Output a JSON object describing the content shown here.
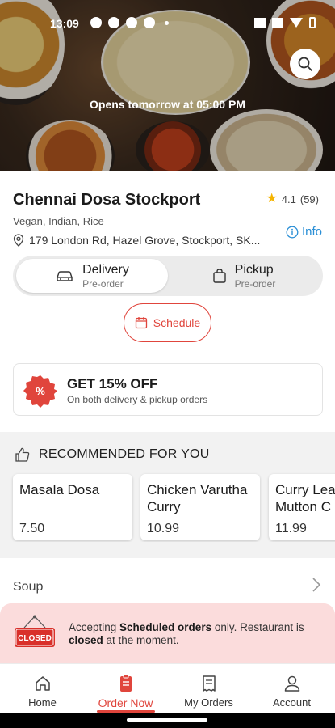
{
  "status_bar": {
    "time": "13:09"
  },
  "hero": {
    "opens_text": "Opens tomorrow at 05:00 PM"
  },
  "restaurant": {
    "name": "Chennai Dosa Stockport",
    "rating": "4.1",
    "rating_count": "(59)",
    "cuisines": "Vegan, Indian, Rice",
    "address": "179 London Rd, Hazel Grove, Stockport, SK...",
    "info_label": "Info"
  },
  "order_type": {
    "delivery": {
      "label": "Delivery",
      "sub": "Pre-order"
    },
    "pickup": {
      "label": "Pickup",
      "sub": "Pre-order"
    }
  },
  "schedule_label": "Schedule",
  "promo": {
    "badge": "%",
    "title": "GET 15% OFF",
    "subtitle": "On both delivery & pickup orders"
  },
  "recommended": {
    "heading": "RECOMMENDED FOR YOU",
    "items": [
      {
        "name": "Masala Dosa",
        "price": "7.50"
      },
      {
        "name": "Chicken Varutha Curry",
        "price": "10.99"
      },
      {
        "name": "Curry Leaf Mutton C",
        "price": "11.99"
      }
    ]
  },
  "category": {
    "label": "Soup"
  },
  "closed_banner": {
    "sign_text": "CLOSED",
    "part1": "Accepting ",
    "bold1": "Scheduled orders",
    "part2": " only. Restaurant is ",
    "bold2": "closed",
    "part3": " at the moment."
  },
  "bottom_nav": [
    {
      "label": "Home",
      "icon": "home-icon"
    },
    {
      "label": "Order Now",
      "icon": "order-icon"
    },
    {
      "label": "My Orders",
      "icon": "receipt-icon"
    },
    {
      "label": "Account",
      "icon": "person-icon"
    }
  ],
  "colors": {
    "accent": "#e0453c",
    "info": "#2a8fd6",
    "star": "#f5b400",
    "banner": "#fbdcdc"
  }
}
